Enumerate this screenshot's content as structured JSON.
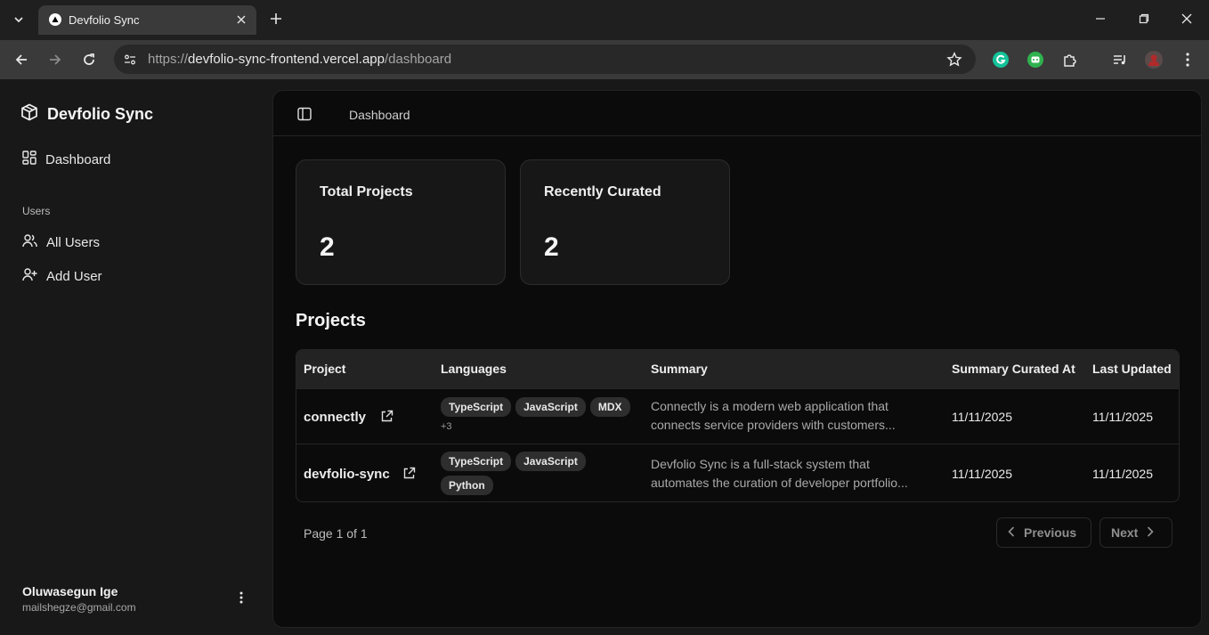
{
  "browser": {
    "tab_title": "Devfolio Sync",
    "url_prefix": "https://",
    "url_host": "devfolio-sync-frontend.vercel.app",
    "url_path": "/dashboard"
  },
  "sidebar": {
    "brand": "Devfolio Sync",
    "dashboard_label": "Dashboard",
    "group_label": "Users",
    "items": [
      {
        "label": "All Users"
      },
      {
        "label": "Add User"
      }
    ],
    "user": {
      "name": "Oluwasegun Ige",
      "email": "mailshegze@gmail.com"
    }
  },
  "header": {
    "breadcrumb": "Dashboard"
  },
  "stats": [
    {
      "label": "Total Projects",
      "value": "2"
    },
    {
      "label": "Recently Curated",
      "value": "2"
    }
  ],
  "projects": {
    "title": "Projects",
    "columns": [
      "Project",
      "Languages",
      "Summary",
      "Summary Curated At",
      "Last Updated"
    ],
    "rows": [
      {
        "name": "connectly",
        "languages": [
          "TypeScript",
          "JavaScript",
          "MDX"
        ],
        "more": "+3",
        "summary_line1": "Connectly is a modern web application that",
        "summary_line2": "connects service providers with customers...",
        "curated_at": "11/11/2025",
        "updated": "11/11/2025"
      },
      {
        "name": "devfolio-sync",
        "languages": [
          "TypeScript",
          "JavaScript",
          "Python"
        ],
        "more": "",
        "summary_line1": "Devfolio Sync is a full-stack system that",
        "summary_line2": "automates the curation of developer portfolio...",
        "curated_at": "11/11/2025",
        "updated": "11/11/2025"
      }
    ],
    "pager": {
      "text": "Page 1 of 1",
      "previous": "Previous",
      "next": "Next"
    }
  },
  "colors": {
    "sidebar_bg": "#181818",
    "main_bg": "#0b0b0b",
    "card_bg": "#171717",
    "badge_bg": "#2e2e2e"
  }
}
